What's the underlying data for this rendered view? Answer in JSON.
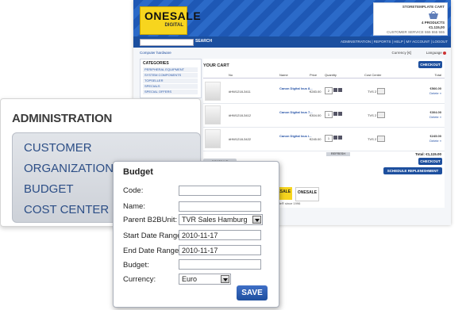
{
  "store": {
    "logo": {
      "line1": "ONESALE",
      "line2": "DIGITAL"
    },
    "minicart": {
      "title": "STORETEMPLATE CART",
      "products": "4 PRODUCTS",
      "total": "€1.115,00",
      "service": "CUSTOMER SERVICE 555 555 555"
    },
    "search": {
      "button": "SEARCH"
    },
    "toplinks": "ADMINISTRATION | REPORTS | HELP | MY ACCOUNT | LOGOUT",
    "breadcrumb": "Computer hardware",
    "currency_label": "Currency [€]",
    "language_label": "Language",
    "categories": {
      "title": "CATEGORIES",
      "items": [
        "PERIPHERAL EQUIPMENT",
        "SYSTEM COMPONENTS",
        "TOPSELLER",
        "SPECIALS",
        "SPECIAL OFFERS"
      ]
    },
    "cart": {
      "title": "YOUR CART",
      "checkout_label": "CHECKOUT",
      "columns": [
        "No",
        "Name",
        "Price",
        "Quantity",
        "Cost Center",
        "Total"
      ],
      "rows": [
        {
          "no": "#HW1218-3411",
          "name": "Canon Digital Ixus 8...",
          "price": "€283.00",
          "qty": "2",
          "cost_center": "TVS 2",
          "total": "€566.00",
          "delete": "Delete »"
        },
        {
          "no": "#HW1218-3412",
          "name": "Canon Digital Ixus 7...",
          "price": "€304.00",
          "qty": "1",
          "cost_center": "TVS 2",
          "total": "€304.00",
          "delete": "Delete »"
        },
        {
          "no": "#HW1218-3422",
          "name": "Canon Digital Ixus i...",
          "price": "€245.00",
          "qty": "1",
          "cost_center": "TVS 2",
          "total": "€245.00",
          "delete": "Delete »"
        }
      ],
      "refresh_label": "REFRESH",
      "grand_total": "Total: €1,115.00",
      "continue_label": "CONTINUE SHOPPING",
      "schedule_label": "SCHEDULE REPLENISHMENT"
    },
    "partners": [
      "ONESALE",
      "ONESALE"
    ],
    "footer": "Onesale® since 1996"
  },
  "admin": {
    "title": "ADMINISTRATION",
    "menu": [
      "CUSTOMER",
      "ORGANIZATION",
      "BUDGET",
      "COST CENTER"
    ]
  },
  "budget_form": {
    "title": "Budget",
    "fields": {
      "code": {
        "label": "Code:",
        "value": ""
      },
      "name": {
        "label": "Name:",
        "value": ""
      },
      "parent": {
        "label": "Parent B2BUnit:",
        "value": "TVR Sales Hamburg"
      },
      "start": {
        "label": "Start Date Range:",
        "value": "2010-11-17"
      },
      "end": {
        "label": "End Date Range:",
        "value": "2010-11-17"
      },
      "budget": {
        "label": "Budget:",
        "value": ""
      },
      "currency": {
        "label": "Currency:",
        "value": "Euro"
      }
    },
    "save_label": "SAVE"
  },
  "colors": {
    "brand_yellow": "#f7d51e",
    "brand_blue": "#1d4f9e",
    "menu_text": "#2c4e86"
  },
  "icons": [
    "shopping-bag-icon",
    "dropdown-arrow-icon",
    "flag-icon"
  ]
}
